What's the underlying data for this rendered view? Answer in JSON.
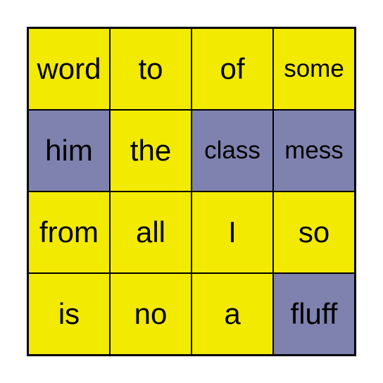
{
  "board": {
    "colors": {
      "unmarked": "#f2ea00",
      "marked": "#7f82ae"
    },
    "cells": [
      {
        "word": "word",
        "marked": false
      },
      {
        "word": "to",
        "marked": false
      },
      {
        "word": "of",
        "marked": false
      },
      {
        "word": "some",
        "marked": false
      },
      {
        "word": "him",
        "marked": true
      },
      {
        "word": "the",
        "marked": false
      },
      {
        "word": "class",
        "marked": true
      },
      {
        "word": "mess",
        "marked": true
      },
      {
        "word": "from",
        "marked": false
      },
      {
        "word": "all",
        "marked": false
      },
      {
        "word": "I",
        "marked": false
      },
      {
        "word": "so",
        "marked": false
      },
      {
        "word": "is",
        "marked": false
      },
      {
        "word": "no",
        "marked": false
      },
      {
        "word": "a",
        "marked": false
      },
      {
        "word": "fluff",
        "marked": true
      }
    ]
  }
}
